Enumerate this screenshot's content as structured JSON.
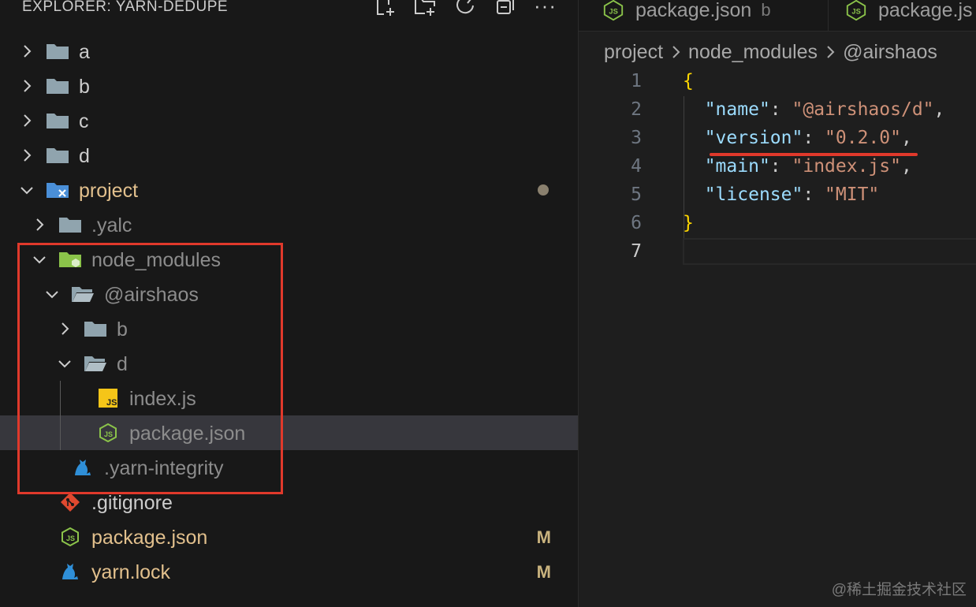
{
  "explorer": {
    "title": "EXPLORER: YARN-DEDUPE",
    "actions": [
      "new-file-icon",
      "new-folder-icon",
      "refresh-icon",
      "collapse-all-icon",
      "more-icon"
    ],
    "more_label": "···",
    "tree": [
      {
        "label": "a",
        "type": "folder",
        "expanded": false
      },
      {
        "label": "b",
        "type": "folder",
        "expanded": false
      },
      {
        "label": "c",
        "type": "folder",
        "expanded": false
      },
      {
        "label": "d",
        "type": "folder",
        "expanded": false
      },
      {
        "label": "project",
        "type": "folder",
        "expanded": true
      },
      {
        "label": ".yalc",
        "type": "folder",
        "expanded": false
      },
      {
        "label": "node_modules",
        "type": "folder",
        "expanded": true
      },
      {
        "label": "@airshaos",
        "type": "folder",
        "expanded": true
      },
      {
        "label": "b",
        "type": "folder",
        "expanded": false
      },
      {
        "label": "d",
        "type": "folder",
        "expanded": true
      },
      {
        "label": "index.js",
        "type": "file"
      },
      {
        "label": "package.json",
        "type": "file",
        "selected": true
      },
      {
        "label": ".yarn-integrity",
        "type": "file"
      },
      {
        "label": ".gitignore",
        "type": "file"
      },
      {
        "label": "package.json",
        "type": "file",
        "status": "M"
      },
      {
        "label": "yarn.lock",
        "type": "file",
        "status": "M"
      }
    ]
  },
  "editor": {
    "tabs": [
      {
        "label": "package.json",
        "description": "b"
      },
      {
        "label": "package.js"
      }
    ],
    "breadcrumb": [
      "project",
      "node_modules",
      "@airshaos"
    ],
    "line_numbers": [
      "1",
      "2",
      "3",
      "4",
      "5",
      "6",
      "7"
    ],
    "code": {
      "open_brace": "{",
      "close_brace": "}",
      "name_key": "\"name\"",
      "name_value": "\"@airshaos/d\"",
      "version_key": "\"version\"",
      "version_value": "\"0.2.0\"",
      "main_key": "\"main\"",
      "main_value": "\"index.js\"",
      "license_key": "\"license\"",
      "license_value": "\"MIT\"",
      "colon": ": ",
      "comma": ","
    }
  },
  "watermark": "@稀土掘金技术社区",
  "colors": {
    "highlight": "#e0392b",
    "modified": "#e2c08d",
    "json_key": "#9cdcfe",
    "json_string": "#ce9178",
    "brace": "#ffd700"
  }
}
